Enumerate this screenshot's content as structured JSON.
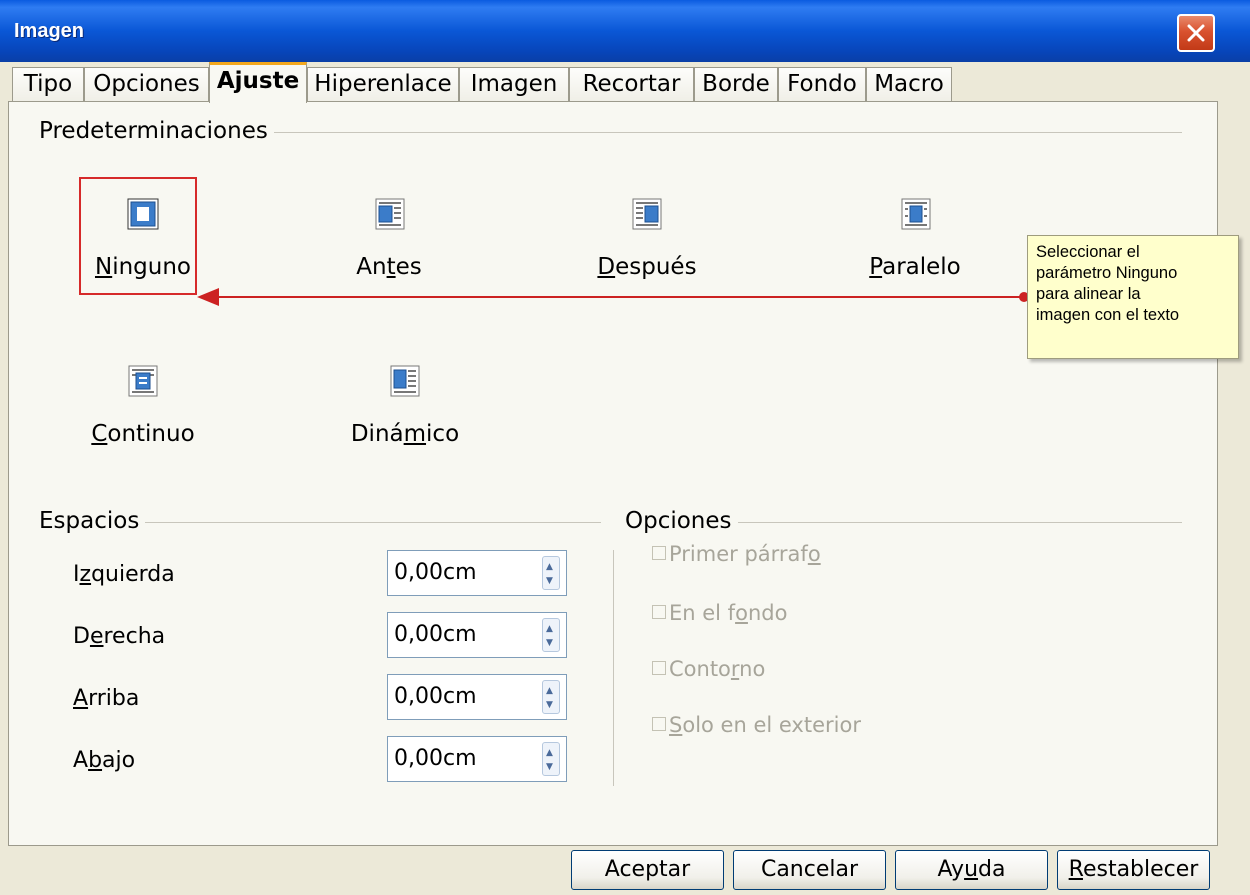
{
  "window": {
    "title": "Imagen"
  },
  "tabs": [
    {
      "label": "Tipo"
    },
    {
      "label": "Opciones"
    },
    {
      "label": "Ajuste"
    },
    {
      "label": "Hiperenlace"
    },
    {
      "label": "Imagen"
    },
    {
      "label": "Recortar"
    },
    {
      "label": "Borde"
    },
    {
      "label": "Fondo"
    },
    {
      "label": "Macro"
    }
  ],
  "active_tab": "Ajuste",
  "presets": {
    "title": "Predeterminaciones",
    "selected": "Ninguno",
    "items": [
      {
        "pre": "",
        "mn": "N",
        "post": "inguno",
        "icon": "wrap-none-icon"
      },
      {
        "pre": "An",
        "mn": "t",
        "post": "es",
        "icon": "wrap-before-icon"
      },
      {
        "pre": "",
        "mn": "D",
        "post": "espués",
        "icon": "wrap-after-icon"
      },
      {
        "pre": "",
        "mn": "P",
        "post": "aralelo",
        "icon": "wrap-parallel-icon"
      },
      {
        "pre": "",
        "mn": "C",
        "post": "ontinuo",
        "icon": "wrap-through-icon"
      },
      {
        "pre": "Diná",
        "mn": "m",
        "post": "ico",
        "icon": "wrap-optimal-icon"
      }
    ]
  },
  "callout": {
    "text": "Seleccionar el\nparámetro Ninguno\npara alinear la\nimagen con el texto"
  },
  "spacing": {
    "title": "Espacios",
    "fields": [
      {
        "pre": "I",
        "mn": "z",
        "post": "quierda",
        "value": "0,00cm"
      },
      {
        "pre": "D",
        "mn": "e",
        "post": "recha",
        "value": "0,00cm"
      },
      {
        "pre": "",
        "mn": "A",
        "post": "rriba",
        "value": "0,00cm"
      },
      {
        "pre": "A",
        "mn": "b",
        "post": "ajo",
        "value": "0,00cm"
      }
    ]
  },
  "options": {
    "title": "Opciones",
    "items": [
      {
        "pre": "Primer párraf",
        "mn": "o",
        "post": "",
        "checked": false,
        "enabled": false
      },
      {
        "pre": "En el f",
        "mn": "o",
        "post": "ndo",
        "checked": false,
        "enabled": false
      },
      {
        "pre": "Conto",
        "mn": "r",
        "post": "no",
        "checked": false,
        "enabled": false
      },
      {
        "pre": "",
        "mn": "S",
        "post": "olo en el exterior",
        "checked": false,
        "enabled": false
      }
    ]
  },
  "buttons": {
    "ok": {
      "pre": "Aceptar",
      "mn": "",
      "post": ""
    },
    "cancel": {
      "pre": "Cancelar",
      "mn": "",
      "post": ""
    },
    "help": {
      "pre": "Ay",
      "mn": "u",
      "post": "da"
    },
    "reset": {
      "pre": "",
      "mn": "R",
      "post": "establecer"
    }
  },
  "colors": {
    "annotation": "#cc2222",
    "titlebar": "#0a57d6",
    "callout_bg": "#ffffcc"
  }
}
